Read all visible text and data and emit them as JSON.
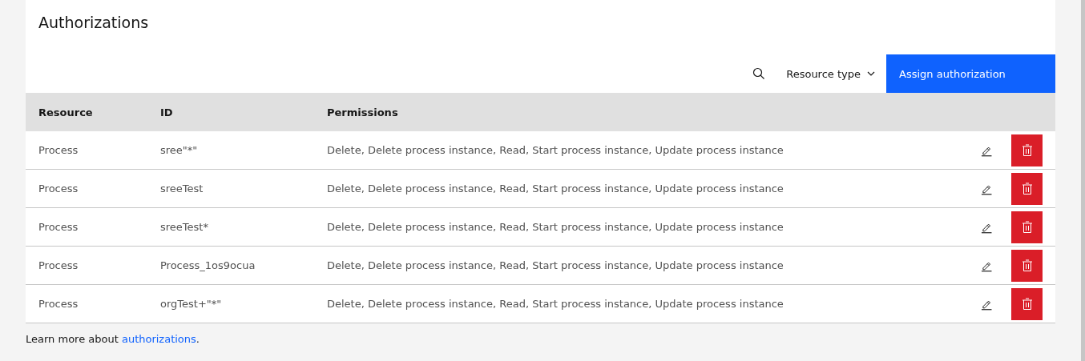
{
  "title": "Authorizations",
  "toolbar": {
    "filter": "Resource type",
    "button": "Assign authorization"
  },
  "table": {
    "columns": [
      "Resource",
      "ID",
      "Permissions"
    ],
    "rows": [
      {
        "resource": "Process",
        "id": "sree\"*\"",
        "permissions": "Delete, Delete process instance, Read, Start process instance, Update process instance"
      },
      {
        "resource": "Process",
        "id": "sreeTest",
        "permissions": "Delete, Delete process instance, Read, Start process instance, Update process instance"
      },
      {
        "resource": "Process",
        "id": "sreeTest*",
        "permissions": "Delete, Delete process instance, Read, Start process instance, Update process instance"
      },
      {
        "resource": "Process",
        "id": "Process_1os9ocua",
        "permissions": "Delete, Delete process instance, Read, Start process instance, Update process instance"
      },
      {
        "resource": "Process",
        "id": "orgTest+\"*\"",
        "permissions": "Delete, Delete process instance, Read, Start process instance, Update process instance"
      }
    ]
  },
  "footer": {
    "before": "Learn more about ",
    "link": "authorizations",
    "after": "."
  }
}
